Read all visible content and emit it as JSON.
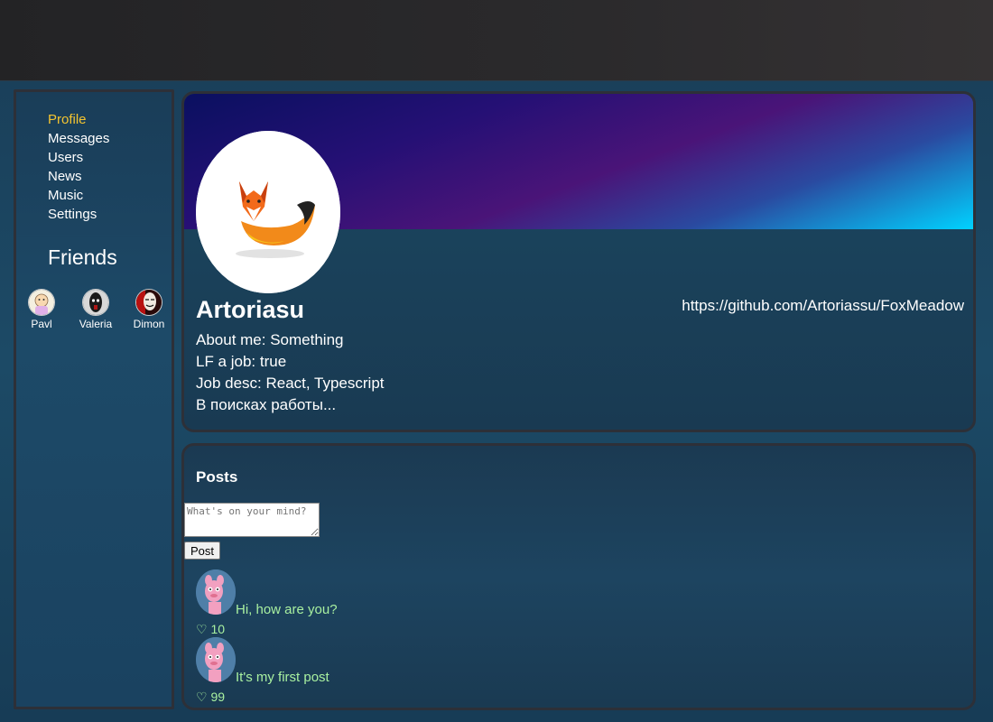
{
  "sidebar": {
    "nav": [
      "Profile",
      "Messages",
      "Users",
      "News",
      "Music",
      "Settings"
    ],
    "active": "Profile",
    "friends_title": "Friends",
    "friends": [
      {
        "name": "Pavl"
      },
      {
        "name": "Valeria"
      },
      {
        "name": "Dimon"
      }
    ]
  },
  "profile": {
    "username": "Artoriasu",
    "github": "https://github.com/Artoriassu/FoxMeadow",
    "about": "About me: Something",
    "lf_job": "LF a job: true",
    "job_desc": "Job desc: React, Typescript",
    "status": "В поисках работы..."
  },
  "posts": {
    "title": "Posts",
    "input_placeholder": "What's on your mind?",
    "button_label": "Post",
    "items": [
      {
        "text": "Hi, how are you?",
        "likes": "♡ 10"
      },
      {
        "text": "It's my first post",
        "likes": "♡ 99"
      }
    ]
  },
  "colors": {
    "active_nav": "#f4c430",
    "post_text": "#a8f0a0"
  }
}
